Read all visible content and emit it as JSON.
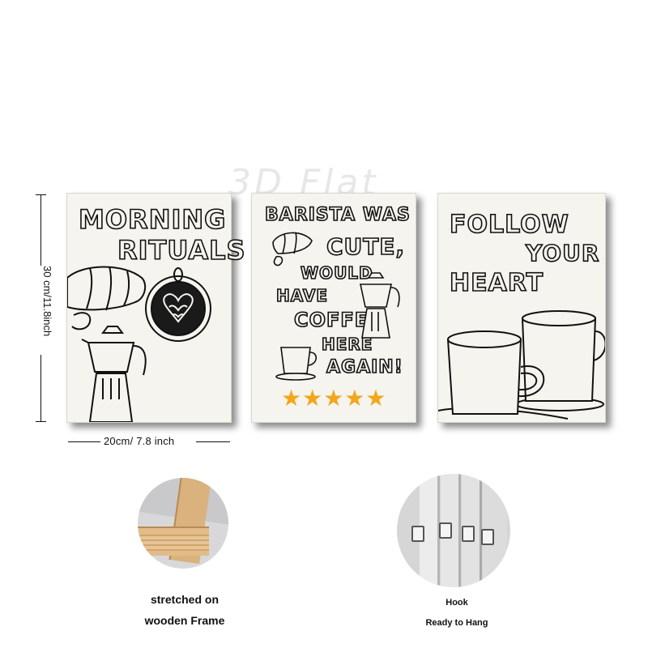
{
  "watermark": "3D Flat",
  "dimensions": {
    "height_label": "30 cm/11.8inch",
    "width_label": "20cm/ 7.8 inch"
  },
  "posters": [
    {
      "title_line1": "MORNING",
      "title_line2": "RITUALS"
    },
    {
      "line1": "BARISTA WAS",
      "line2": "CUTE,",
      "line3": "WOULD",
      "line4": "HAVE",
      "line5": "COFFEE",
      "line6": "HERE",
      "line7": "AGAIN!",
      "stars": "★★★★★"
    },
    {
      "title_line1": "FOLLOW",
      "title_line2": "YOUR",
      "title_line3": "HEART"
    }
  ],
  "details": {
    "frame_caption_line1": "stretched on",
    "frame_caption_line2": "wooden Frame",
    "hook_caption_line1": "Hook",
    "hook_caption_line2": "Ready to Hang"
  },
  "colors": {
    "star": "#f2a61c",
    "canvas": "#f5f4ee",
    "wood": "#d9b27e"
  }
}
